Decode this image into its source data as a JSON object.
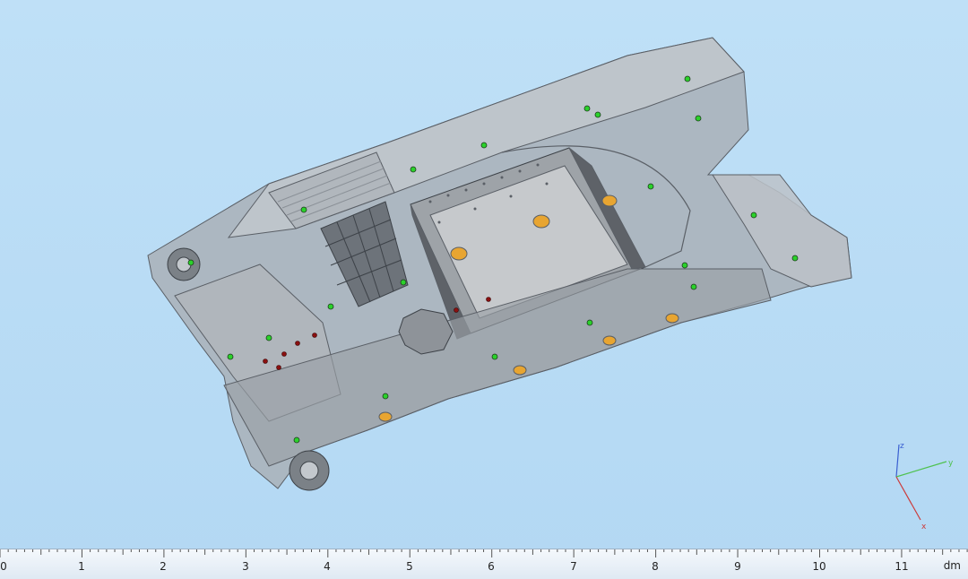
{
  "viewport": {
    "model": "tank hull 3D model",
    "background_color": "#b8dbf5",
    "marker_colors": {
      "green": "#2bd12b",
      "red": "#8a1010"
    }
  },
  "axes_triad": {
    "z": "z",
    "y": "y",
    "x": "x"
  },
  "ruler": {
    "unit": "dm",
    "ticks": [
      "0",
      "1",
      "2",
      "3",
      "4",
      "5",
      "6",
      "7",
      "8",
      "9",
      "10",
      "11"
    ]
  }
}
